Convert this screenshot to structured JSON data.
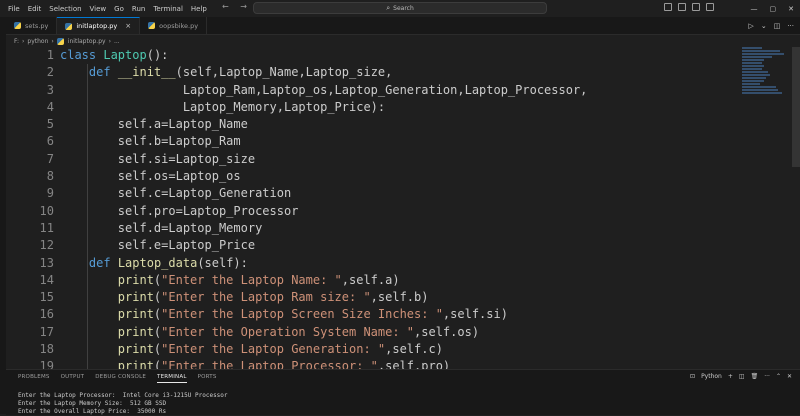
{
  "menu": [
    "File",
    "Edit",
    "Selection",
    "View",
    "Go",
    "Run",
    "Terminal",
    "Help"
  ],
  "search": {
    "placeholder": "Search",
    "icon": "search-icon"
  },
  "nav": {
    "back": "←",
    "forward": "→"
  },
  "window": {
    "minimize": "—",
    "maximize": "▢",
    "close": "✕"
  },
  "tabs": [
    {
      "label": "sets.py",
      "active": false
    },
    {
      "label": "initlaptop.py",
      "active": true,
      "close": "×"
    },
    {
      "label": "oopsbike.py",
      "active": false
    }
  ],
  "editor_actions": {
    "run": "▷",
    "run_menu": "⌄",
    "split": "◫",
    "more": "···"
  },
  "breadcrumb": {
    "drive": "F:",
    "folder": "python",
    "file": "initlaptop.py",
    "tail": "..."
  },
  "code": {
    "line_numbers": [
      "1",
      "2",
      "3",
      "4",
      "5",
      "6",
      "7",
      "8",
      "9",
      "10",
      "11",
      "12",
      "13",
      "14",
      "15",
      "16",
      "17",
      "18",
      "19"
    ],
    "l1": {
      "kw": "class",
      "name": "Laptop",
      "rest": "():"
    },
    "l2": {
      "kw": "def",
      "name": "__init__",
      "rest": "(self,Laptop_Name,Laptop_size,"
    },
    "l3": {
      "text": "Laptop_Ram,Laptop_os,Laptop_Generation,Laptop_Processor,"
    },
    "l4": {
      "text": "Laptop_Memory,Laptop_Price):"
    },
    "l5": {
      "text": "self.a=Laptop_Name"
    },
    "l6": {
      "text": "self.b=Laptop_Ram"
    },
    "l7": {
      "text": "self.si=Laptop_size"
    },
    "l8": {
      "text": "self.os=Laptop_os"
    },
    "l9": {
      "text": "self.c=Laptop_Generation"
    },
    "l10": {
      "text": "self.pro=Laptop_Processor"
    },
    "l11": {
      "text": "self.d=Laptop_Memory"
    },
    "l12": {
      "text": "self.e=Laptop_Price"
    },
    "l13": {
      "kw": "def",
      "name": "Laptop_data",
      "rest": "(self):"
    },
    "l14": {
      "fn": "print",
      "str": "\"Enter the Laptop Name: \"",
      "rest": ",self.a)"
    },
    "l15": {
      "fn": "print",
      "str": "\"Enter the Laptop Ram size: \"",
      "rest": ",self.b)"
    },
    "l16": {
      "fn": "print",
      "str": "\"Enter the Laptop Screen Size Inches: \"",
      "rest": ",self.si)"
    },
    "l17": {
      "fn": "print",
      "str": "\"Enter the Operation System Name: \"",
      "rest": ",self.os)"
    },
    "l18": {
      "fn": "print",
      "str": "\"Enter the Laptop Generation: \"",
      "rest": ",self.c)"
    },
    "l19": {
      "fn": "print",
      "str": "\"Enter the Laptop Processor: \"",
      "rest": ",self.pro)"
    }
  },
  "panel": {
    "tabs": [
      "PROBLEMS",
      "OUTPUT",
      "DEBUG CONSOLE",
      "TERMINAL",
      "PORTS"
    ],
    "active_tab": "TERMINAL",
    "shell": "Python",
    "actions": {
      "add": "+",
      "split": "◫",
      "trash": "🗑",
      "more": "···",
      "maximize": "⌃",
      "close": "✕"
    }
  },
  "terminal": {
    "lines": [
      "Enter the Laptop Processor:  Intel Core i3-1215U Processor",
      "Enter the Laptop Memory Size:  512 GB SSD",
      "Enter the Overall Laptop Price:  35000 Rs"
    ]
  },
  "colors": {
    "keyword": "#569cd6",
    "class": "#4ec9b0",
    "function": "#dcdcaa",
    "string": "#ce9178",
    "accent": "#0078d4"
  }
}
